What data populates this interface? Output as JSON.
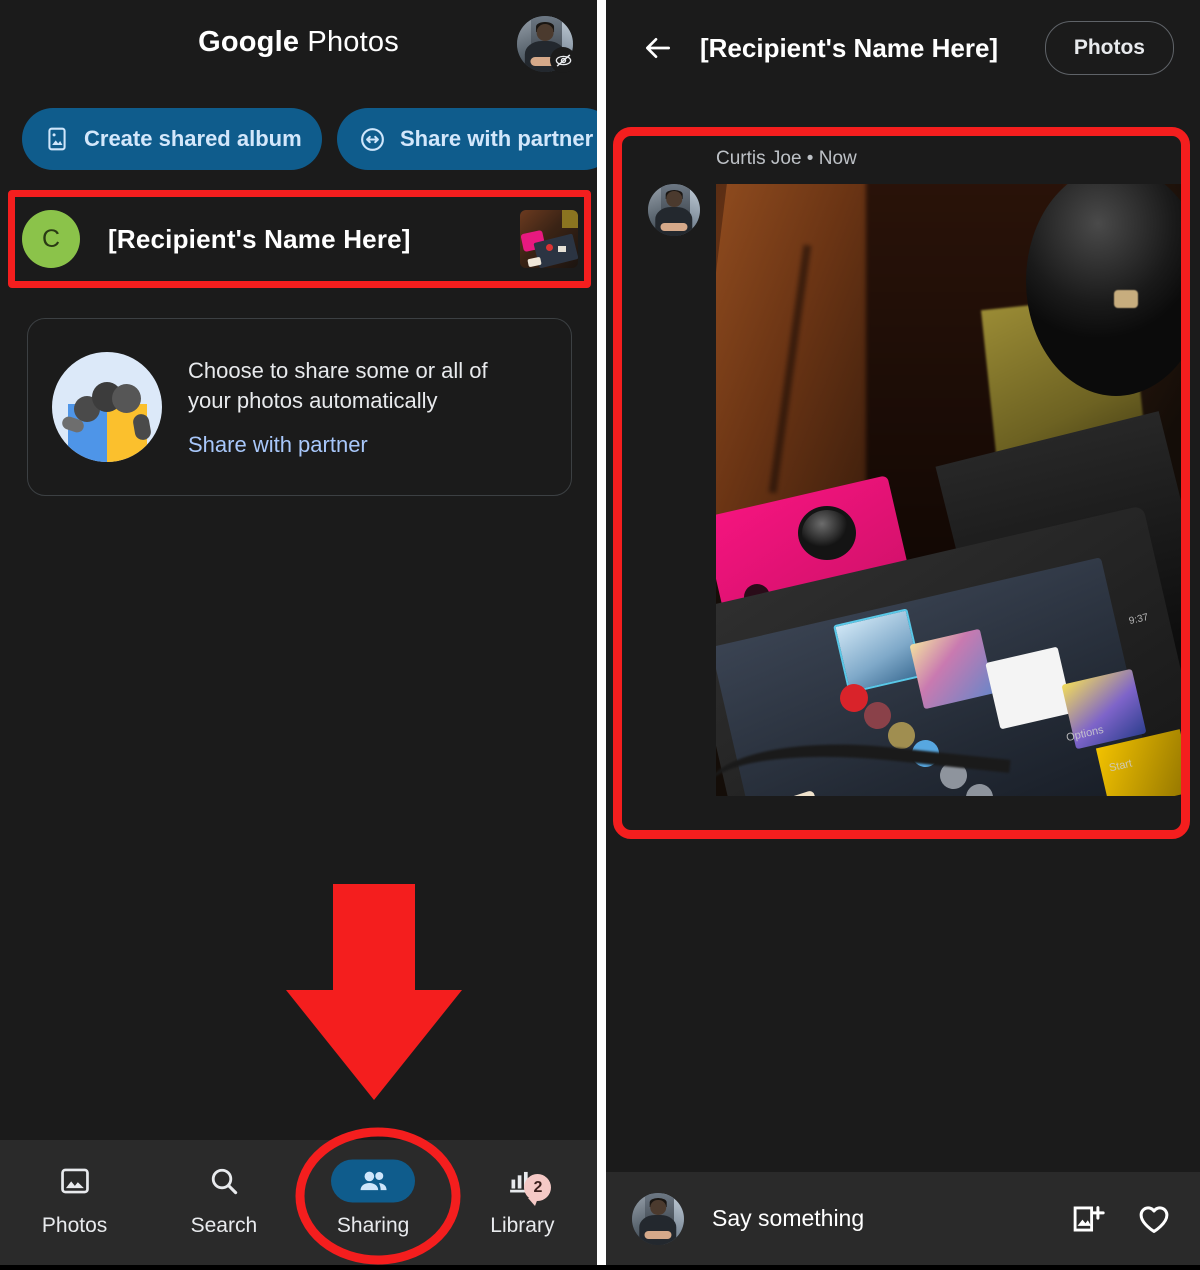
{
  "left_panel": {
    "app_title_bold": "Google",
    "app_title_light": "Photos",
    "account_avatar": "account-avatar",
    "sync_paused_icon": "sync-paused-icon",
    "actions": [
      {
        "id": "create-shared-album",
        "label": "Create shared album",
        "icon": "album-image-icon"
      },
      {
        "id": "share-with-partner",
        "label": "Share with partner",
        "icon": "partner-sharing-icon"
      }
    ],
    "recipient": {
      "initial": "C",
      "name": "[Recipient's Name Here]",
      "thumbnail": "nintendo-switch-photo-thumbnail",
      "avatar_color": "#8bc34a"
    },
    "promo": {
      "illustration": "partner-sharing-illustration",
      "title": "Choose to share some or all of your photos automatically",
      "link": "Share with partner",
      "link_color": "#a8c7fa"
    },
    "nav": [
      {
        "id": "photos",
        "label": "Photos",
        "icon": "photo-icon",
        "active": false,
        "badge": ""
      },
      {
        "id": "search",
        "label": "Search",
        "icon": "search-icon",
        "active": false,
        "badge": ""
      },
      {
        "id": "sharing",
        "label": "Sharing",
        "icon": "people-icon",
        "active": true,
        "badge": ""
      },
      {
        "id": "library",
        "label": "Library",
        "icon": "library-icon",
        "active": false,
        "badge": "2"
      }
    ]
  },
  "right_panel": {
    "back_icon": "back-arrow-icon",
    "title": "[Recipient's Name Here]",
    "photos_button": "Photos",
    "post": {
      "author": "Curtis Joe",
      "separator": "•",
      "time": "Now",
      "meta": "Curtis Joe • Now",
      "avatar": "curtis-joe-avatar",
      "photo_alt": "nintendo-switch-on-desk-photo"
    },
    "comment_bar": {
      "avatar": "curtis-joe-avatar",
      "placeholder": "Say something",
      "add_photo_icon": "add-photo-icon",
      "heart_icon": "heart-icon"
    }
  },
  "annotations": {
    "color": "#f41e1e",
    "items": [
      {
        "id": "recipient-row-highlight",
        "shape": "rectangle"
      },
      {
        "id": "shared-post-highlight",
        "shape": "rounded-rectangle"
      },
      {
        "id": "sharing-tab-pointer",
        "shape": "down-arrow"
      },
      {
        "id": "sharing-tab-highlight",
        "shape": "ellipse"
      }
    ]
  }
}
